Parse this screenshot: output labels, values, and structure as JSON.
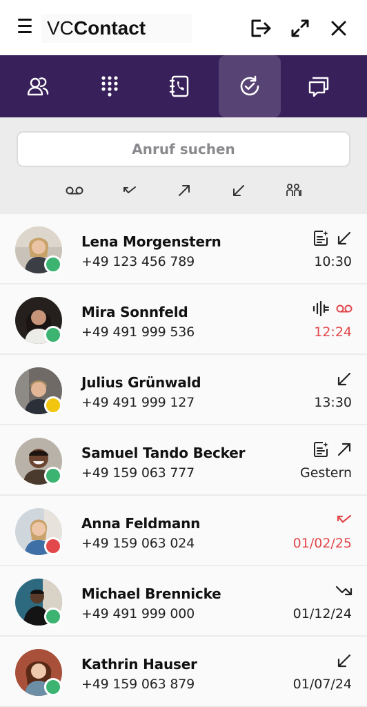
{
  "app": {
    "title_prefix": "VC",
    "title_bold": "Contact"
  },
  "colors": {
    "brand_purple": "#38205b",
    "status_online": "#3cb371",
    "status_away": "#f2c511",
    "status_busy": "#e2484b",
    "missed": "#e2484b"
  },
  "titlebar_icons": [
    "menu-icon",
    "logout-icon",
    "expand-icon",
    "close-icon"
  ],
  "nav_tabs": [
    {
      "icon": "contacts-icon",
      "active": false
    },
    {
      "icon": "dialpad-icon",
      "active": false
    },
    {
      "icon": "phonebook-icon",
      "active": false
    },
    {
      "icon": "call-history-icon",
      "active": true
    },
    {
      "icon": "chat-icon",
      "active": false
    }
  ],
  "search": {
    "placeholder": "Anruf suchen"
  },
  "filters": [
    "voicemail-icon",
    "missed-call-icon",
    "outgoing-call-icon",
    "incoming-call-icon",
    "group-icon"
  ],
  "calls": [
    {
      "name": "Lena Morgenstern",
      "phone": "+49 123 456 789",
      "time": "10:30",
      "status": "online",
      "direction": "incoming",
      "extra": "transcript",
      "missed": false
    },
    {
      "name": "Mira Sonnfeld",
      "phone": "+49 491 999 536",
      "time": "12:24",
      "status": "online",
      "direction": "voicemail",
      "extra": "audio",
      "missed": true
    },
    {
      "name": "Julius Grünwald",
      "phone": "+49 491 999 127",
      "time": "13:30",
      "status": "away",
      "direction": "incoming",
      "extra": "",
      "missed": false
    },
    {
      "name": "Samuel Tando Becker",
      "phone": "+49 159 063 777",
      "time": "Gestern",
      "status": "online",
      "direction": "outgoing",
      "extra": "transcript",
      "missed": false
    },
    {
      "name": "Anna Feldmann",
      "phone": "+49 159 063 024",
      "time": "01/02/25",
      "status": "busy",
      "direction": "missed",
      "extra": "",
      "missed": true
    },
    {
      "name": "Michael Brennicke",
      "phone": "+49 491 999 000",
      "time": "01/12/24",
      "status": "online",
      "direction": "forwarded",
      "extra": "",
      "missed": false
    },
    {
      "name": "Kathrin Hauser",
      "phone": "+49 159 063 879",
      "time": "01/07/24",
      "status": "online",
      "direction": "incoming",
      "extra": "",
      "missed": false
    }
  ]
}
